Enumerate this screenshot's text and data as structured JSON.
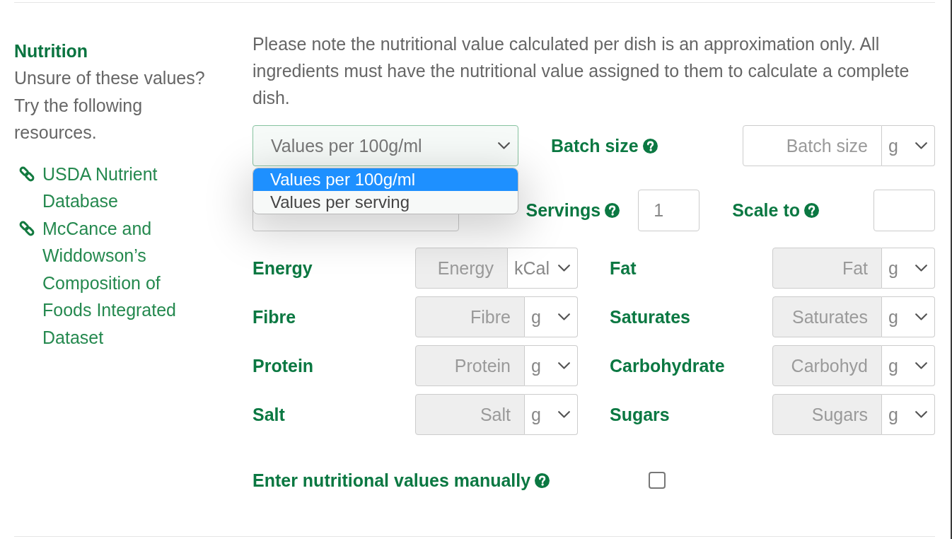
{
  "sidebar": {
    "title": "Nutrition",
    "description": "Unsure of these values? Try the following resources.",
    "links": [
      {
        "label": "USDA Nutrient Database"
      },
      {
        "label": "McCance and Widdowson’s Composition of Foods Integrated Dataset"
      }
    ]
  },
  "notice": "Please note the nutritional value calculated per dish is an approximation only. All ingredients must have the nutritional value assigned to them to calculate a complete dish.",
  "basis_select": {
    "value": "Values per 100g/ml",
    "expanded": true,
    "options": [
      {
        "label": "Values per 100g/ml",
        "selected": true
      },
      {
        "label": "Values per serving",
        "selected": false
      }
    ]
  },
  "batch_size": {
    "label": "Batch size",
    "help": true,
    "placeholder": "Batch size",
    "unit": "g",
    "disabled": false
  },
  "servings": {
    "label": "Servings",
    "help": true,
    "value": "1"
  },
  "scale_to": {
    "label": "Scale to",
    "help": true
  },
  "nutrients": [
    {
      "label": "Energy",
      "placeholder": "Energy",
      "unit": "kCal",
      "disabled": true
    },
    {
      "label": "Fat",
      "placeholder": "Fat",
      "unit": "g",
      "disabled": true
    },
    {
      "label": "Fibre",
      "placeholder": "Fibre",
      "unit": "g",
      "disabled": true
    },
    {
      "label": "Saturates",
      "placeholder": "Saturates",
      "unit": "g",
      "disabled": true
    },
    {
      "label": "Protein",
      "placeholder": "Protein",
      "unit": "g",
      "disabled": true
    },
    {
      "label": "Carbohydrate",
      "placeholder": "Carbohyd",
      "unit": "g",
      "disabled": true
    },
    {
      "label": "Salt",
      "placeholder": "Salt",
      "unit": "g",
      "disabled": true
    },
    {
      "label": "Sugars",
      "placeholder": "Sugars",
      "unit": "g",
      "disabled": true
    }
  ],
  "manual_entry": {
    "label": "Enter nutritional values manually",
    "help": true,
    "checked": false
  }
}
